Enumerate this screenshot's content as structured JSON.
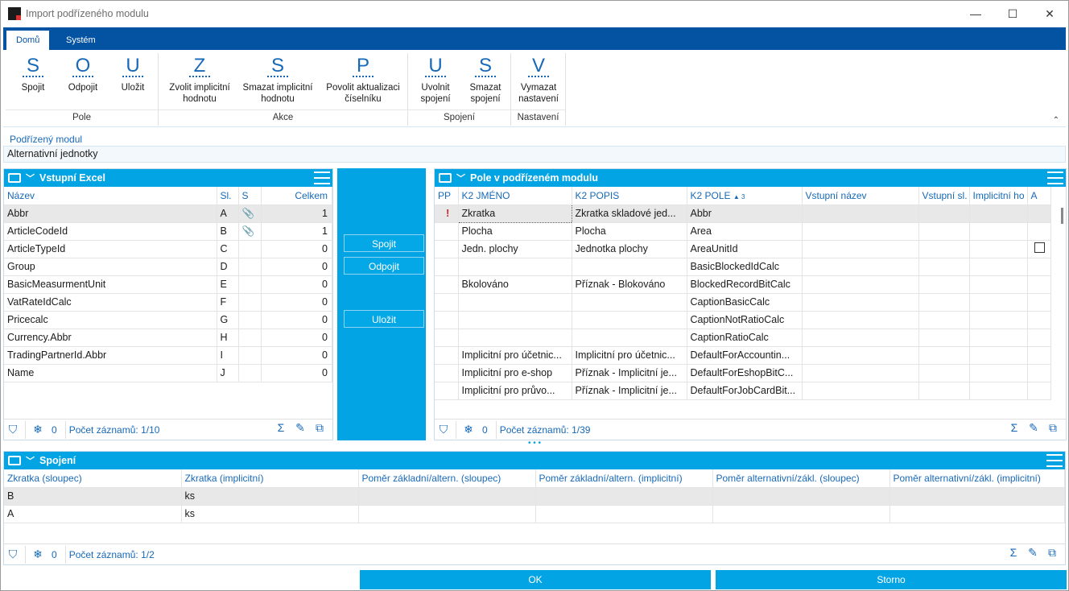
{
  "window": {
    "title": "Import podřízeného modulu",
    "btn_min": "—",
    "btn_max": "☐",
    "btn_close": "✕"
  },
  "tabs": [
    {
      "label": "Domů"
    },
    {
      "label": "Systém"
    }
  ],
  "ribbon": {
    "groups": [
      {
        "label": "Pole",
        "buttons": [
          {
            "key": "S",
            "label": "Spojit"
          },
          {
            "key": "O",
            "label": "Odpojit"
          },
          {
            "key": "U",
            "label": "Uložit"
          }
        ]
      },
      {
        "label": "Akce",
        "buttons": [
          {
            "key": "Z",
            "label": "Zvolit implicitní hodnotu"
          },
          {
            "key": "S",
            "label": "Smazat implicitní hodnotu"
          },
          {
            "key": "P",
            "label": "Povolit aktualizaci číselníku"
          }
        ]
      },
      {
        "label": "Spojení",
        "buttons": [
          {
            "key": "U",
            "label": "Uvolnit spojení"
          },
          {
            "key": "S",
            "label": "Smazat spojení"
          }
        ]
      },
      {
        "label": "Nastavení",
        "buttons": [
          {
            "key": "V",
            "label": "Vymazat nastavení"
          }
        ]
      }
    ],
    "collapse_icon": "chevron-up-icon"
  },
  "submodule": {
    "label": "Podřízený modul",
    "value": "Alternativní jednotky"
  },
  "excel_panel": {
    "title": "Vstupní Excel",
    "columns": [
      "Název",
      "Sl.",
      "S",
      "Celkem"
    ],
    "rows": [
      {
        "name": "Abbr",
        "col": "A",
        "clip": "📎",
        "total": "1"
      },
      {
        "name": "ArticleCodeId",
        "col": "B",
        "clip": "📎",
        "total": "1"
      },
      {
        "name": "ArticleTypeId",
        "col": "C",
        "clip": "",
        "total": "0"
      },
      {
        "name": "Group",
        "col": "D",
        "clip": "",
        "total": "0"
      },
      {
        "name": "BasicMeasurmentUnit",
        "col": "E",
        "clip": "",
        "total": "0"
      },
      {
        "name": "VatRateIdCalc",
        "col": "F",
        "clip": "",
        "total": "0"
      },
      {
        "name": "Pricecalc",
        "col": "G",
        "clip": "",
        "total": "0"
      },
      {
        "name": "Currency.Abbr",
        "col": "H",
        "clip": "",
        "total": "0"
      },
      {
        "name": "TradingPartnerId.Abbr",
        "col": "I",
        "clip": "",
        "total": "0"
      },
      {
        "name": "Name",
        "col": "J",
        "clip": "",
        "total": "0"
      }
    ],
    "footer": {
      "filter_count": "0",
      "records": "Počet záznamů: 1/10"
    }
  },
  "middle": {
    "spojit": "Spojit",
    "odpojit": "Odpojit",
    "ulozit": "Uložit"
  },
  "fields_panel": {
    "title": "Pole v podřízeném modulu",
    "columns": [
      "PP",
      "K2 JMÉNO",
      "K2 POPIS",
      "K2 POLE",
      "Vstupní název",
      "Vstupní sl.",
      "Implicitní ho",
      "A"
    ],
    "sort_mark": "▲ 3",
    "rows": [
      {
        "pp": "!",
        "name": "Zkratka",
        "desc": "Zkratka skladové jed...",
        "field": "Abbr",
        "chk": false
      },
      {
        "pp": "",
        "name": "Plocha",
        "desc": "Plocha",
        "field": "Area",
        "chk": false
      },
      {
        "pp": "",
        "name": "Jedn. plochy",
        "desc": "Jednotka plochy",
        "field": "AreaUnitId",
        "chk": true
      },
      {
        "pp": "",
        "name": "",
        "desc": "",
        "field": "BasicBlockedIdCalc",
        "chk": false
      },
      {
        "pp": "",
        "name": "Bkolováno",
        "desc": "Příznak - Blokováno",
        "field": "BlockedRecordBitCalc",
        "chk": false
      },
      {
        "pp": "",
        "name": "",
        "desc": "",
        "field": "CaptionBasicCalc",
        "chk": false
      },
      {
        "pp": "",
        "name": "",
        "desc": "",
        "field": "CaptionNotRatioCalc",
        "chk": false
      },
      {
        "pp": "",
        "name": "",
        "desc": "",
        "field": "CaptionRatioCalc",
        "chk": false
      },
      {
        "pp": "",
        "name": "Implicitní pro účetnic...",
        "desc": "Implicitní pro účetnic...",
        "field": "DefaultForAccountin...",
        "chk": false
      },
      {
        "pp": "",
        "name": "Implicitní pro e-shop",
        "desc": "Příznak - Implicitní je...",
        "field": "DefaultForEshopBitC...",
        "chk": false
      },
      {
        "pp": "",
        "name": "Implicitní pro průvo...",
        "desc": "Příznak - Implicitní je...",
        "field": "DefaultForJobCardBit...",
        "chk": false
      }
    ],
    "footer": {
      "filter_count": "0",
      "records": "Počet záznamů: 1/39"
    }
  },
  "links_panel": {
    "title": "Spojení",
    "columns": [
      "Zkratka (sloupec)",
      "Zkratka (implicitní)",
      "Poměr základní/altern. (sloupec)",
      "Poměr základní/altern. (implicitní)",
      "Poměr alternativní/zákl. (sloupec)",
      "Poměr alternativní/zákl. (implicitní)"
    ],
    "rows": [
      {
        "c1": "B",
        "c2": "ks",
        "c3": "",
        "c4": "",
        "c5": "",
        "c6": ""
      },
      {
        "c1": "A",
        "c2": "ks",
        "c3": "",
        "c4": "",
        "c5": "",
        "c6": ""
      }
    ],
    "footer": {
      "filter_count": "0",
      "records": "Počet záznamů: 1/2"
    }
  },
  "buttons": {
    "ok": "OK",
    "cancel": "Storno"
  },
  "colors": {
    "accent": "#03a4e3",
    "brand": "#0452a2",
    "link": "#1769b8"
  }
}
